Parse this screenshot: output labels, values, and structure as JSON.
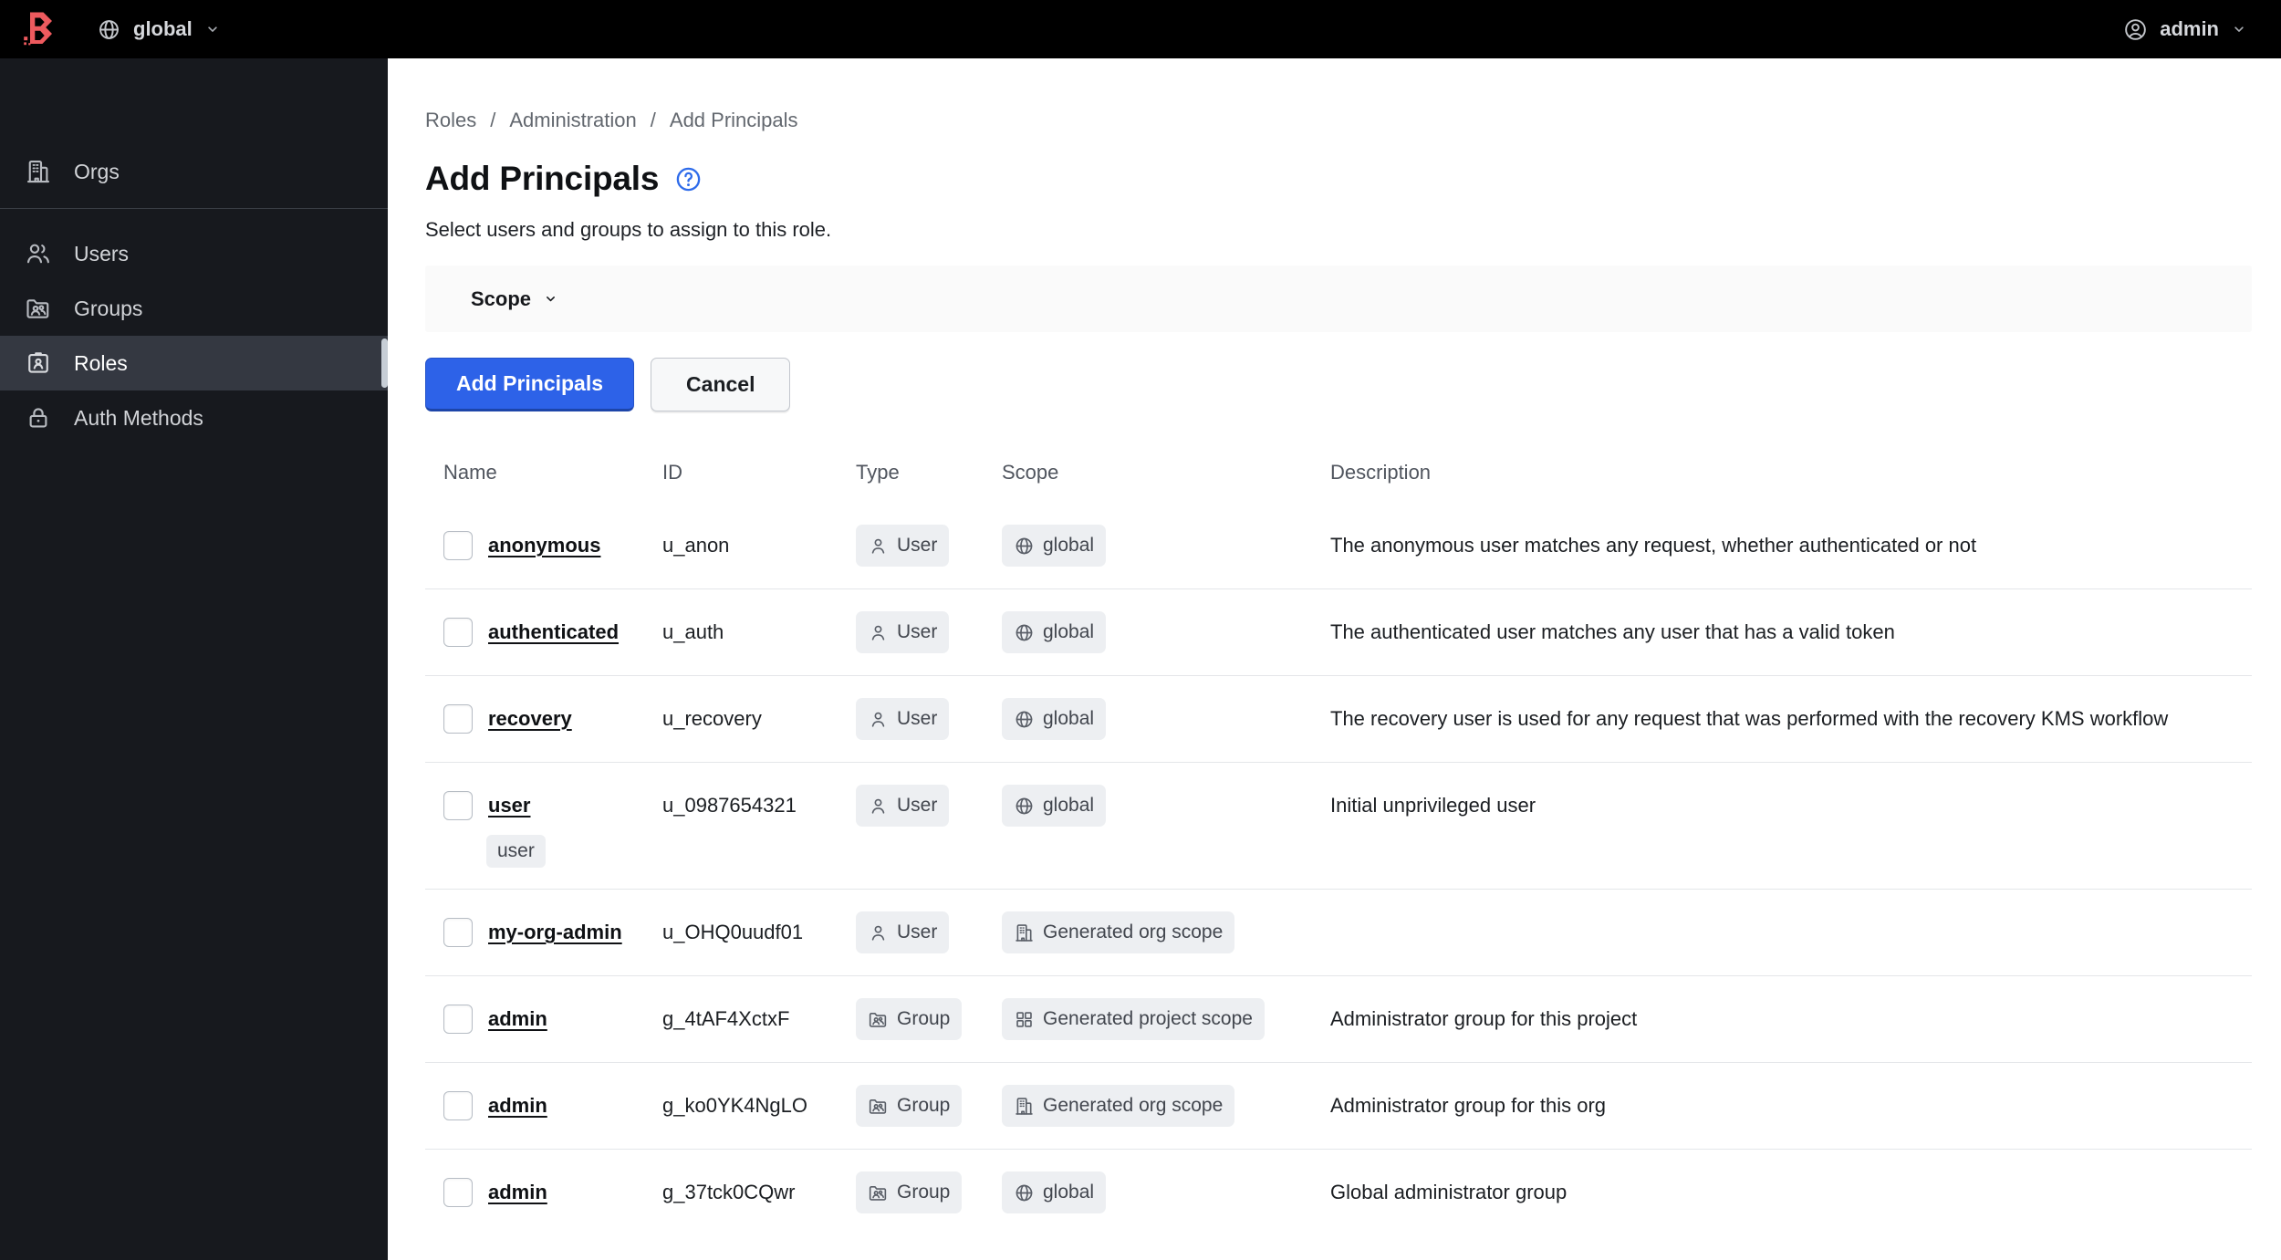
{
  "colors": {
    "brand_red": "#ee5a5e",
    "topbar_bg": "#000000",
    "sidebar_bg": "#17191e",
    "sidebar_active_bg": "#343841",
    "primary_button_blue": "#2d62e8",
    "help_icon_blue": "#2e6bea",
    "badge_bg": "#edeff2",
    "row_border": "#e4e6e9",
    "filter_bar_bg": "#fafafa"
  },
  "topbar": {
    "logo_icon": "boundary-logo",
    "scope_icon": "globe",
    "scope_label": "global",
    "chevron_icon": "chevron-down",
    "user_icon": "account",
    "user_label": "admin"
  },
  "sidebar": {
    "top_items": [
      {
        "label": "Orgs",
        "icon": "building"
      }
    ],
    "items": [
      {
        "label": "Users",
        "icon": "users"
      },
      {
        "label": "Groups",
        "icon": "group"
      },
      {
        "label": "Roles",
        "icon": "role",
        "active": true
      },
      {
        "label": "Auth Methods",
        "icon": "lock"
      }
    ]
  },
  "breadcrumb": {
    "separator": "/",
    "items": [
      {
        "label": "Roles"
      },
      {
        "label": "Administration"
      },
      {
        "label": "Add Principals"
      }
    ]
  },
  "page": {
    "title": "Add Principals",
    "help_icon": "help",
    "subtitle": "Select users and groups to assign to this role."
  },
  "filter_bar": {
    "label": "Scope",
    "chevron_icon": "chevron-down"
  },
  "actions": {
    "submit_label": "Add Principals",
    "cancel_label": "Cancel"
  },
  "table": {
    "columns": [
      "Name",
      "ID",
      "Type",
      "Scope",
      "Description"
    ],
    "rows": [
      {
        "name": "anonymous",
        "id": "u_anon",
        "type": "User",
        "type_icon": "user",
        "scope": "global",
        "scope_icon": "globe",
        "description": "The anonymous user matches any request, whether authenticated or not"
      },
      {
        "name": "authenticated",
        "id": "u_auth",
        "type": "User",
        "type_icon": "user",
        "scope": "global",
        "scope_icon": "globe",
        "description": "The authenticated user matches any user that has a valid token"
      },
      {
        "name": "recovery",
        "id": "u_recovery",
        "type": "User",
        "type_icon": "user",
        "scope": "global",
        "scope_icon": "globe",
        "description": "The recovery user is used for any request that was performed with the recovery KMS workflow"
      },
      {
        "name": "user",
        "tag": "user",
        "id": "u_0987654321",
        "type": "User",
        "type_icon": "user",
        "scope": "global",
        "scope_icon": "globe",
        "description": "Initial unprivileged user"
      },
      {
        "name": "my-org-admin",
        "id": "u_OHQ0uudf01",
        "type": "User",
        "type_icon": "user",
        "scope": "Generated org scope",
        "scope_icon": "building",
        "description": ""
      },
      {
        "name": "admin",
        "id": "g_4tAF4XctxF",
        "type": "Group",
        "type_icon": "group",
        "scope": "Generated project scope",
        "scope_icon": "grid",
        "description": "Administrator group for this project"
      },
      {
        "name": "admin",
        "id": "g_ko0YK4NgLO",
        "type": "Group",
        "type_icon": "group",
        "scope": "Generated org scope",
        "scope_icon": "building",
        "description": "Administrator group for this org"
      },
      {
        "name": "admin",
        "id": "g_37tck0CQwr",
        "type": "Group",
        "type_icon": "group",
        "scope": "global",
        "scope_icon": "globe",
        "description": "Global administrator group"
      }
    ]
  }
}
